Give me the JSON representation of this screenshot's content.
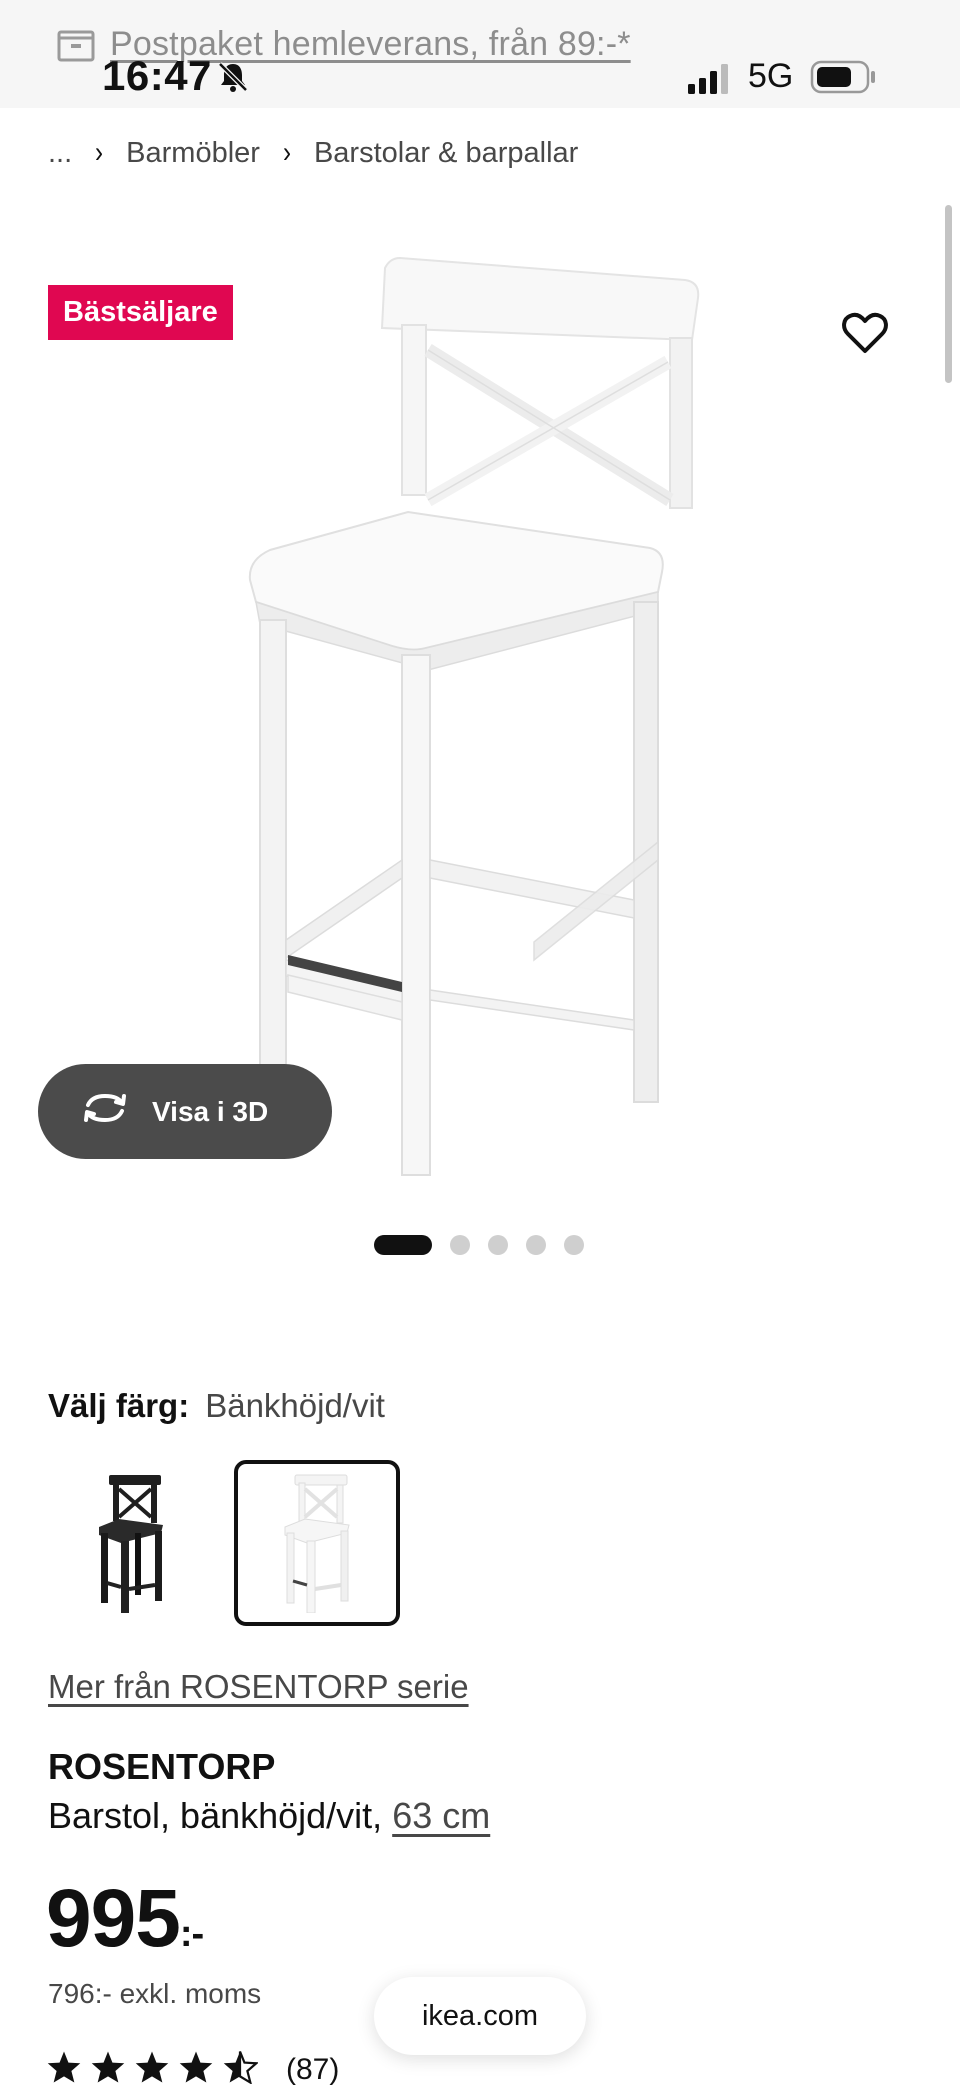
{
  "promo": {
    "text": "Postpaket hemleverans, från 89:-*",
    "icon": "box-icon"
  },
  "status_bar": {
    "time": "16:47",
    "network": "5G",
    "icons": [
      "bell-muted-icon",
      "signal-icon",
      "battery-icon"
    ]
  },
  "breadcrumb": {
    "items": [
      "...",
      "Barmöbler",
      "Barstolar & barpallar"
    ],
    "separator": "›"
  },
  "hero": {
    "badge": "Bästsäljare",
    "view_3d_label": "Visa i 3D",
    "image_count": 5,
    "active_image": 1
  },
  "color": {
    "label": "Välj färg:",
    "value": "Bänkhöjd/vit",
    "options": [
      "black",
      "white"
    ],
    "selected": "white"
  },
  "series_link": "Mer från ROSENTORP serie",
  "product": {
    "name": "ROSENTORP",
    "desc": "Barstol, bänkhöjd/vit, ",
    "size": "63 cm"
  },
  "price": {
    "amount": "995",
    "suffix": ":-",
    "excl_vat": "796:- exkl. moms"
  },
  "rating": {
    "stars": 4.5,
    "count": "(87)"
  },
  "url": "ikea.com",
  "colors": {
    "badge": "#e00751",
    "button": "#4b4b4b",
    "text": "#111111",
    "muted": "#484848"
  }
}
